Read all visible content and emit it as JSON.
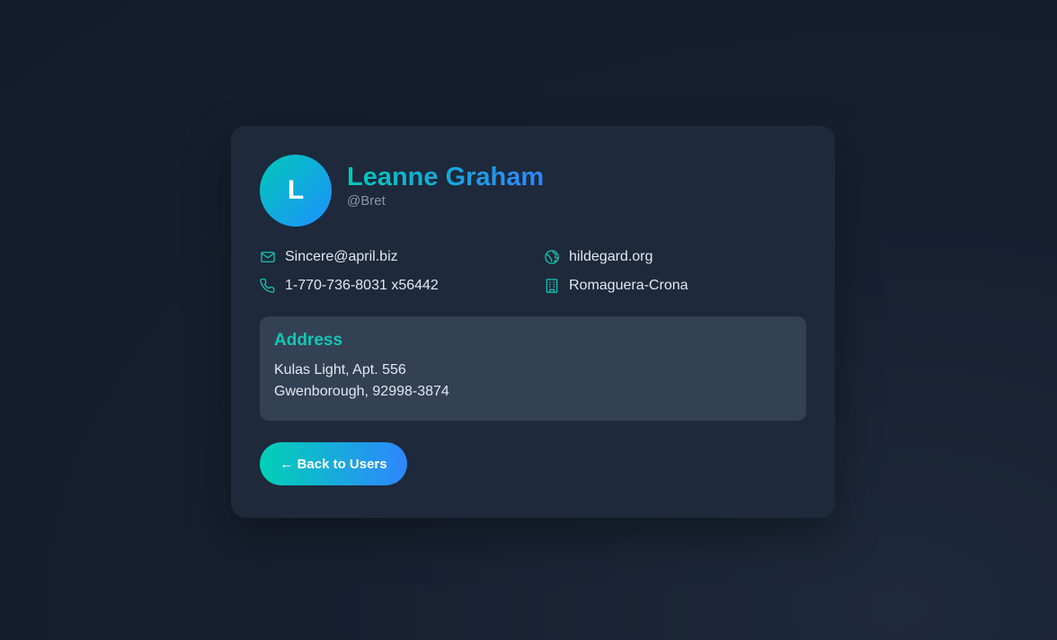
{
  "user": {
    "avatar_initial": "L",
    "name": "Leanne Graham",
    "username": "@Bret"
  },
  "contact": {
    "email": "Sincere@april.biz",
    "website": "hildegard.org",
    "phone": "1-770-736-8031 x56442",
    "company": "Romaguera-Crona"
  },
  "icons": {
    "email": "mail-icon",
    "website": "globe-icon",
    "phone": "phone-icon",
    "company": "building-icon"
  },
  "address": {
    "title": "Address",
    "line1": "Kulas Light, Apt. 556",
    "line2": "Gwenborough, 92998-3874"
  },
  "actions": {
    "back_label": "← Back to Users"
  },
  "colors": {
    "accent_teal": "#14c6b3",
    "accent_blue": "#2f86ff",
    "card_bg": "#1e293b",
    "address_bg": "#334155"
  }
}
